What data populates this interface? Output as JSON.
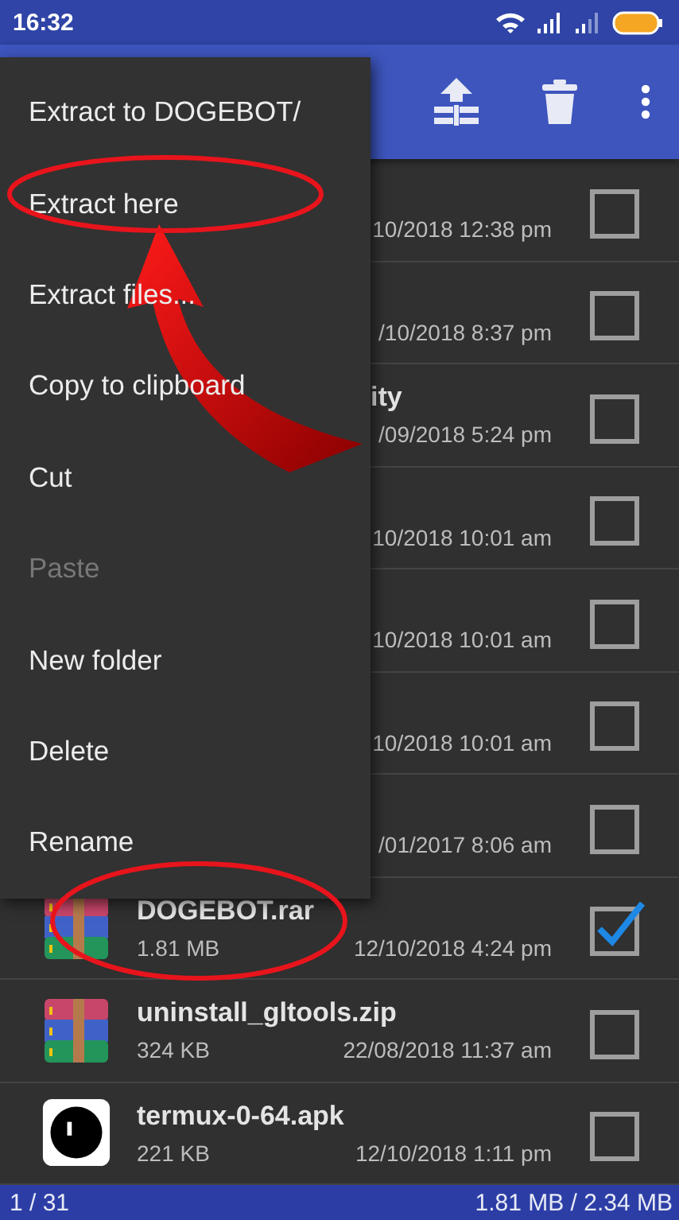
{
  "status_bar": {
    "time": "16:32"
  },
  "menu": {
    "items": [
      {
        "label": "Extract to DOGEBOT/",
        "disabled": false
      },
      {
        "label": "Extract here",
        "disabled": false
      },
      {
        "label": "Extract files...",
        "disabled": false
      },
      {
        "label": "Copy to clipboard",
        "disabled": false
      },
      {
        "label": "Cut",
        "disabled": false
      },
      {
        "label": "Paste",
        "disabled": true
      },
      {
        "label": "New folder",
        "disabled": false
      },
      {
        "label": "Delete",
        "disabled": false
      },
      {
        "label": "Rename",
        "disabled": false
      }
    ]
  },
  "files": [
    {
      "kind": "covered",
      "modified": "10/2018 12:38 pm",
      "checked": false
    },
    {
      "kind": "covered",
      "modified": "/10/2018 8:37 pm",
      "checked": false
    },
    {
      "kind": "covered",
      "name": "ity",
      "modified": "/09/2018 5:24 pm",
      "checked": false
    },
    {
      "kind": "covered",
      "modified": "10/2018 10:01 am",
      "checked": false
    },
    {
      "kind": "covered",
      "modified": "10/2018 10:01 am",
      "checked": false
    },
    {
      "kind": "covered",
      "modified": "10/2018 10:01 am",
      "checked": false
    },
    {
      "kind": "covered",
      "modified": "/01/2017 8:06 am",
      "checked": false
    },
    {
      "kind": "archive",
      "name": "DOGEBOT.rar",
      "size": "1.81 MB",
      "modified": "12/10/2018 4:24 pm",
      "checked": true
    },
    {
      "kind": "archive",
      "name": "uninstall_gltools.zip",
      "size": "324 KB",
      "modified": "22/08/2018 11:37 am",
      "checked": false
    },
    {
      "kind": "apk",
      "name": "termux-0-64.apk",
      "size": "221 KB",
      "modified": "12/10/2018 1:11 pm",
      "checked": false
    }
  ],
  "footer": {
    "count": "1 / 31",
    "size": "1.81 MB / 2.34 MB"
  }
}
